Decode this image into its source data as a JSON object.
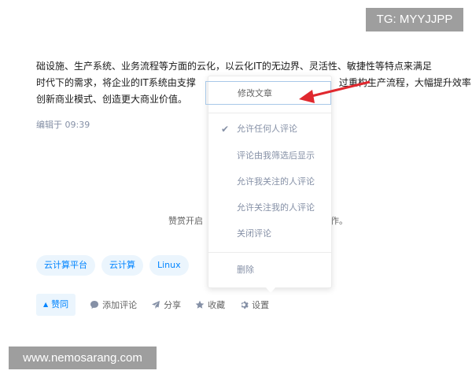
{
  "watermarks": {
    "top_right": "TG: MYYJJPP",
    "bottom_left": "www.nemosarang.com"
  },
  "article": {
    "line1": "础设施、生产系统、业务流程等方面的云化，以云化IT的无边界、灵活性、敏捷性等特点来满足",
    "line2": "时代下的需求，将企业的IT系统由支撑",
    "line2_tail": "过重构生产流程，大幅提升效率",
    "line3": "创新商业模式、创造更大商业价值。",
    "edited": "编辑于 09:39"
  },
  "reward": {
    "text": "赞赏开启",
    "tail": "作。"
  },
  "tags": [
    "云计算平台",
    "云计算",
    "Linux"
  ],
  "actions": {
    "vote": "赞同",
    "comment": "添加评论",
    "share": "分享",
    "favorite": "收藏",
    "settings": "设置"
  },
  "menu": {
    "edit": "修改文章",
    "comment_options": [
      "允许任何人评论",
      "评论由我筛选后显示",
      "允许我关注的人评论",
      "允许关注我的人评论",
      "关闭评论"
    ],
    "selected_option": "允许任何人评论",
    "delete": "删除"
  },
  "colors": {
    "accent": "#0084ff",
    "arrow": "#e0282e",
    "tag_bg": "#ebf5fd"
  },
  "icons": [
    "check-icon",
    "triangle-up-icon",
    "comment-bubble-icon",
    "paper-plane-icon",
    "star-icon",
    "gear-icon",
    "red-arrow-annotation"
  ]
}
